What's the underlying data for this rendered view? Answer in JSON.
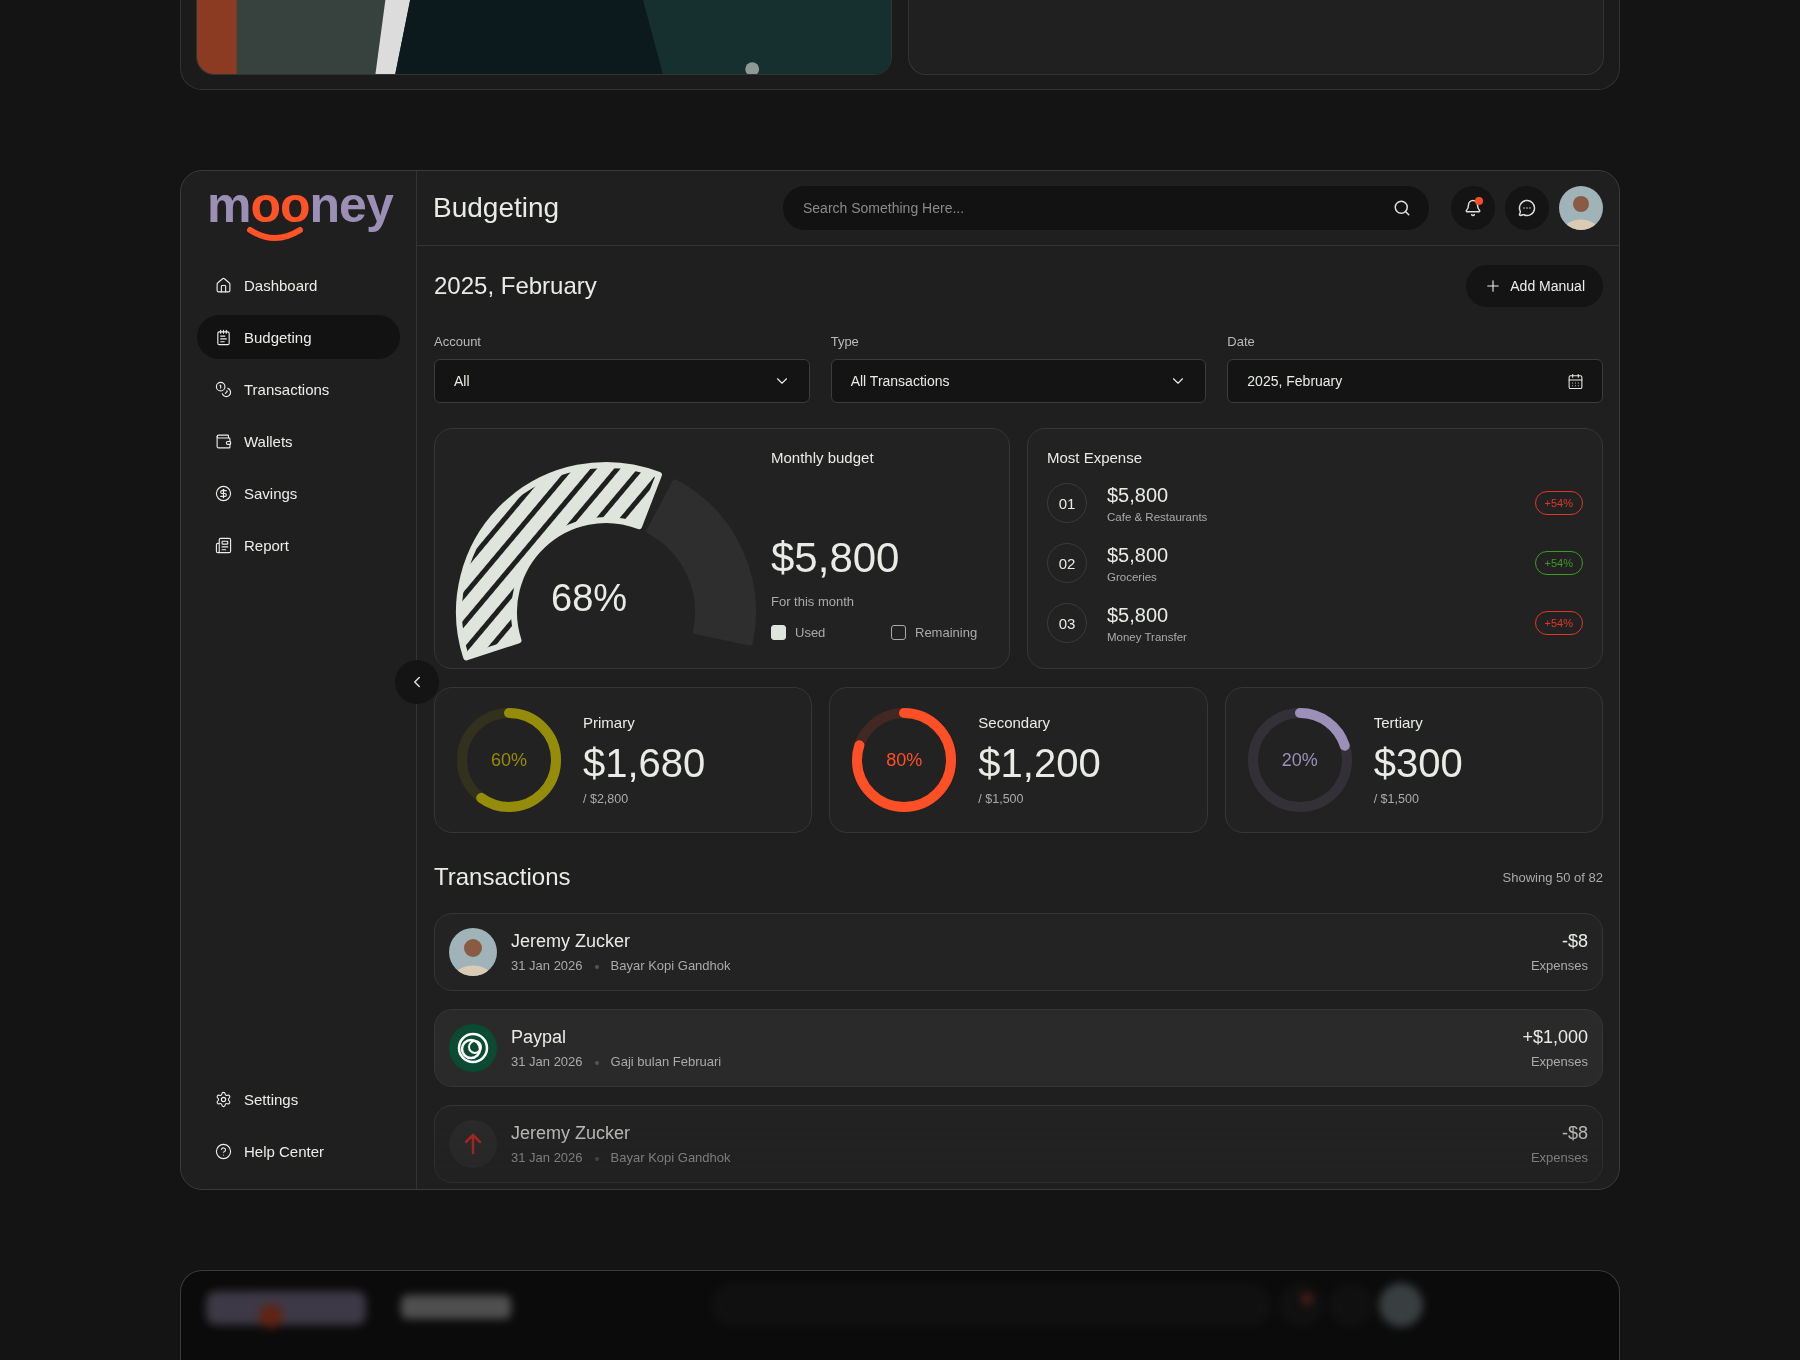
{
  "sidebar": {
    "logo": {
      "lead": "m",
      "accent": "oo",
      "tail": "ney"
    },
    "items": [
      {
        "label": "Dashboard",
        "selected": false
      },
      {
        "label": "Budgeting",
        "selected": true
      },
      {
        "label": "Transactions",
        "selected": false
      },
      {
        "label": "Wallets",
        "selected": false
      },
      {
        "label": "Savings",
        "selected": false
      },
      {
        "label": "Report",
        "selected": false
      }
    ],
    "footer_items": [
      {
        "label": "Settings",
        "selected": false
      },
      {
        "label": "Help Center",
        "selected": false
      }
    ]
  },
  "header": {
    "title": "Budgeting",
    "search": {
      "placeholder": "Search Something Here..."
    },
    "notifications": {
      "unread": true
    }
  },
  "page": {
    "title": "2025, February",
    "add_button": "Add Manual"
  },
  "filters": [
    {
      "label": "Account",
      "value": "All",
      "kind": "select"
    },
    {
      "label": "Type",
      "value": "All Transactions",
      "kind": "select"
    },
    {
      "label": "Date",
      "value": "2025, February",
      "kind": "date"
    }
  ],
  "monthly_budget": {
    "title": "Monthly budget",
    "level": 0.68,
    "percent": "68%",
    "amount": "$5,800",
    "caption": "For this month",
    "legend": [
      {
        "label": "Used",
        "kind": "used"
      },
      {
        "label": "Remaining",
        "kind": "remaining"
      }
    ]
  },
  "most_expense": {
    "title": "Most Expense",
    "items": [
      {
        "rank": "01",
        "amount": "$5,800",
        "category": "Cafe & Restaurants",
        "change": "+54%",
        "color": "#e0352b"
      },
      {
        "rank": "02",
        "amount": "$5,800",
        "category": "Groceries",
        "change": "+54%",
        "color": "#3c9a25"
      },
      {
        "rank": "03",
        "amount": "$5,800",
        "category": "Money Transfer",
        "change": "+54%",
        "color": "#e0352b"
      }
    ]
  },
  "accounts": [
    {
      "name": "Primary",
      "percent": "60%",
      "level": 0.6,
      "amount": "$1,680",
      "limit": "/ $2,800",
      "color": "#958d0a"
    },
    {
      "name": "Secondary",
      "percent": "80%",
      "level": 0.8,
      "amount": "$1,200",
      "limit": "/ $1,500",
      "color": "#ff4f27"
    },
    {
      "name": "Tertiary",
      "percent": "20%",
      "level": 0.2,
      "amount": "$300",
      "limit": "/ $1,500",
      "color": "#9d90b8"
    }
  ],
  "transactions": {
    "title": "Transactions",
    "count": "Showing 50 of 82",
    "rows": [
      {
        "name": "Jeremy Zucker",
        "date": "31 Jan 2026",
        "note": "Bayar Kopi Gandhok",
        "amount": "-$8",
        "type": "Expenses",
        "kind": "person"
      },
      {
        "name": "Paypal",
        "date": "31 Jan 2026",
        "note": "Gaji bulan Februari",
        "amount": "+$1,000",
        "type": "Expenses",
        "kind": "paypal"
      },
      {
        "name": "Jeremy Zucker",
        "date": "31 Jan 2026",
        "note": "Bayar Kopi Gandhok",
        "amount": "-$8",
        "type": "Expenses",
        "kind": "arrow"
      }
    ]
  }
}
